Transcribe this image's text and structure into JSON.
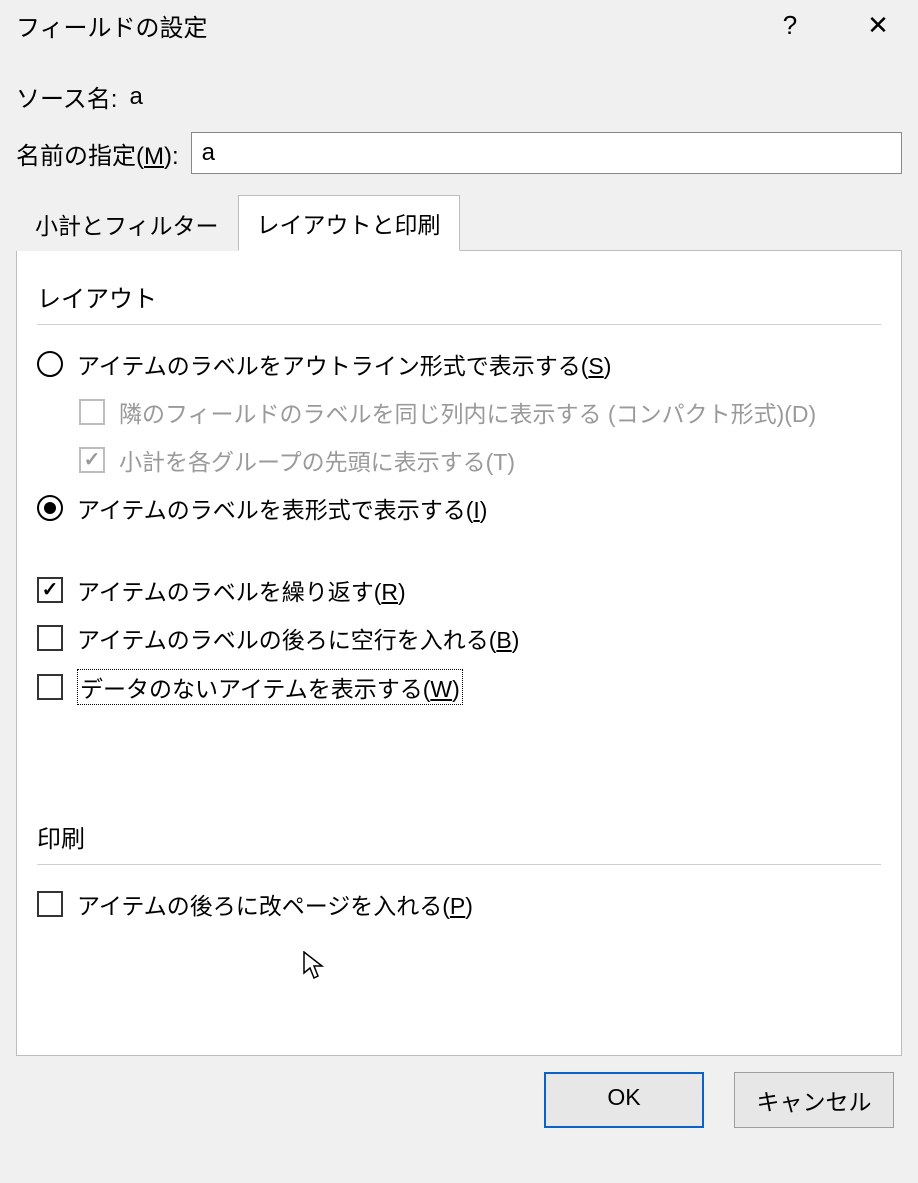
{
  "titlebar": {
    "title": "フィールドの設定"
  },
  "source": {
    "label": "ソース名:",
    "value": "a"
  },
  "name": {
    "label": "名前の指定(",
    "mnemonic": "M",
    "label_after": "):",
    "value": "a"
  },
  "tabs": {
    "subtotals": "小計とフィルター",
    "layout": "レイアウトと印刷"
  },
  "sections": {
    "layout": "レイアウト",
    "print": "印刷"
  },
  "options": {
    "outline": {
      "pre": "アイテムのラベルをアウトライン形式で表示する(",
      "m": "S",
      "post": ")"
    },
    "compact": {
      "pre": "隣のフィールドのラベルを同じ列内に表示する (コンパクト形式)(",
      "m": "D",
      "post": ")"
    },
    "subtotal_top": {
      "pre": "小計を各グループの先頭に表示する(",
      "m": "T",
      "post": ")"
    },
    "tabular": {
      "pre": "アイテムのラベルを表形式で表示する(",
      "m": "I",
      "post": ")"
    },
    "repeat": {
      "pre": "アイテムのラベルを繰り返す(",
      "m": "R",
      "post": ")"
    },
    "blank": {
      "pre": "アイテムのラベルの後ろに空行を入れる(",
      "m": "B",
      "post": ")"
    },
    "show_empty": {
      "pre": "データのないアイテムを表示する(",
      "m": "W",
      "post": ")"
    },
    "page_break": {
      "pre": "アイテムの後ろに改ページを入れる(",
      "m": "P",
      "post": ")"
    }
  },
  "buttons": {
    "ok": "OK",
    "cancel": "キャンセル"
  }
}
